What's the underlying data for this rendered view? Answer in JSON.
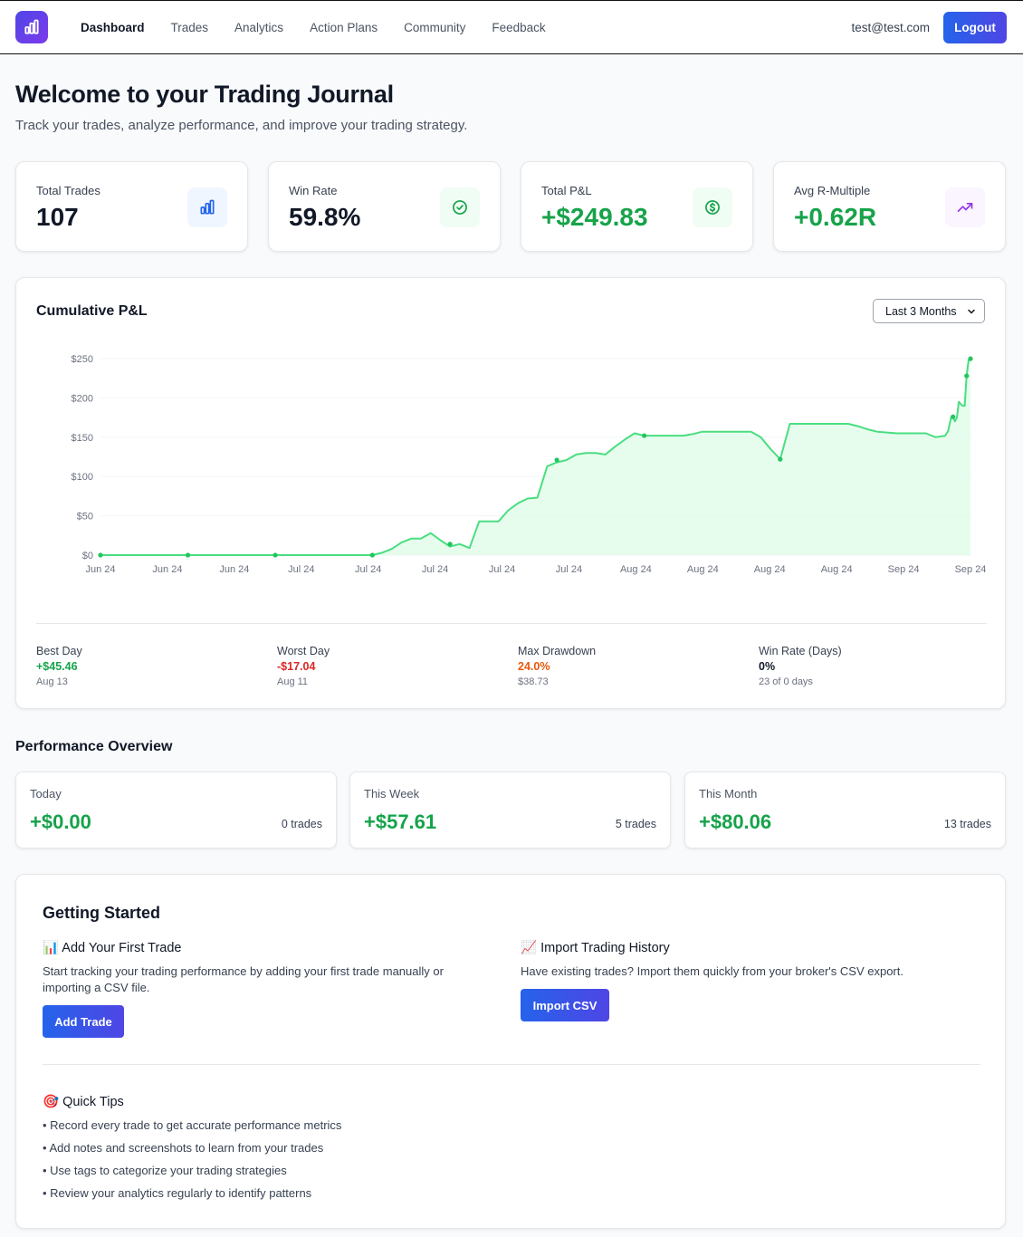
{
  "nav": {
    "items": [
      {
        "label": "Dashboard",
        "active": true
      },
      {
        "label": "Trades"
      },
      {
        "label": "Analytics"
      },
      {
        "label": "Action Plans"
      },
      {
        "label": "Community"
      },
      {
        "label": "Feedback"
      }
    ],
    "user_email": "test@test.com",
    "logout_label": "Logout"
  },
  "header": {
    "title": "Welcome to your Trading Journal",
    "subtitle": "Track your trades, analyze performance, and improve your trading strategy."
  },
  "stats": [
    {
      "label": "Total Trades",
      "value": "107",
      "icon": "bar-chart-icon"
    },
    {
      "label": "Win Rate",
      "value": "59.8%",
      "icon": "check-circle-icon"
    },
    {
      "label": "Total P&L",
      "value": "+$249.83",
      "icon": "dollar-circle-icon"
    },
    {
      "label": "Avg R-Multiple",
      "value": "+0.62R",
      "icon": "trend-up-icon"
    }
  ],
  "chart_card": {
    "title": "Cumulative P&L",
    "range_selected": "Last 3 Months"
  },
  "chart_data": {
    "type": "area",
    "title": "Cumulative P&L",
    "xlabel": "",
    "ylabel": "",
    "ylim": [
      0,
      250
    ],
    "y_ticks": [
      "$0",
      "$50",
      "$100",
      "$150",
      "$200",
      "$250"
    ],
    "y_tick_values": [
      0,
      50,
      100,
      150,
      200,
      250
    ],
    "x_tick_labels": [
      "Jun 24",
      "Jun 24",
      "Jun 24",
      "Jul 24",
      "Jul 24",
      "Jul 24",
      "Jul 24",
      "Jul 24",
      "Aug 24",
      "Aug 24",
      "Aug 24",
      "Aug 24",
      "Sep 24",
      "Sep 24"
    ],
    "x_range": [
      0,
      88
    ],
    "grid": true,
    "line_color": "#4ade80",
    "fill_color": "#dcfce7",
    "points": [
      [
        0,
        0
      ],
      [
        9,
        0
      ],
      [
        18,
        0
      ],
      [
        27,
        0
      ],
      [
        28,
        0
      ],
      [
        29,
        3
      ],
      [
        30,
        8
      ],
      [
        31,
        16
      ],
      [
        32,
        21
      ],
      [
        33,
        21
      ],
      [
        34,
        28
      ],
      [
        35,
        19
      ],
      [
        36,
        11
      ],
      [
        37,
        14
      ],
      [
        38,
        9
      ],
      [
        39,
        43
      ],
      [
        40,
        43
      ],
      [
        41,
        43
      ],
      [
        42,
        57
      ],
      [
        43,
        66
      ],
      [
        44,
        72
      ],
      [
        45,
        73
      ],
      [
        46,
        113
      ],
      [
        47,
        118
      ],
      [
        48,
        121
      ],
      [
        49,
        128
      ],
      [
        50,
        130
      ],
      [
        51,
        130
      ],
      [
        52,
        128
      ],
      [
        53,
        138
      ],
      [
        54,
        147
      ],
      [
        55,
        155
      ],
      [
        56,
        152
      ],
      [
        57,
        152
      ],
      [
        58,
        152
      ],
      [
        59,
        152
      ],
      [
        60,
        152
      ],
      [
        61,
        154
      ],
      [
        62,
        157
      ],
      [
        63,
        157
      ],
      [
        64,
        157
      ],
      [
        65,
        157
      ],
      [
        66,
        157
      ],
      [
        67,
        157
      ],
      [
        68,
        150
      ],
      [
        69,
        135
      ],
      [
        70,
        122
      ],
      [
        71,
        167
      ],
      [
        72,
        167
      ],
      [
        73,
        167
      ],
      [
        74,
        167
      ],
      [
        75,
        167
      ],
      [
        76,
        167
      ],
      [
        77,
        167
      ],
      [
        78,
        164
      ],
      [
        79,
        160
      ],
      [
        80,
        157
      ],
      [
        81,
        156
      ],
      [
        82,
        155
      ],
      [
        83,
        155
      ],
      [
        84,
        155
      ],
      [
        85,
        155
      ],
      [
        86,
        150
      ],
      [
        87,
        152
      ]
    ],
    "points_tail": [
      [
        87.3,
        158
      ],
      [
        87.6,
        175
      ],
      [
        87.8,
        176
      ],
      [
        88.0,
        170
      ],
      [
        88.2,
        175
      ],
      [
        88.4,
        195
      ],
      [
        88.6,
        192
      ],
      [
        88.8,
        190
      ],
      [
        89.0,
        190
      ],
      [
        89.2,
        228
      ],
      [
        89.4,
        248
      ],
      [
        89.6,
        249.83
      ]
    ],
    "markers": [
      [
        0,
        0
      ],
      [
        9,
        0
      ],
      [
        18,
        0
      ],
      [
        28,
        0
      ],
      [
        36,
        14
      ],
      [
        47,
        121
      ],
      [
        56,
        152
      ],
      [
        70,
        122
      ],
      [
        87.8,
        176
      ],
      [
        89.2,
        228
      ],
      [
        89.6,
        249.83
      ]
    ]
  },
  "chart_metrics": [
    {
      "label": "Best Day",
      "value": "+$45.46",
      "sub": "Aug 13",
      "color": "#16a34a"
    },
    {
      "label": "Worst Day",
      "value": "-$17.04",
      "sub": "Aug 11",
      "color": "#dc2626"
    },
    {
      "label": "Max Drawdown",
      "value": "24.0%",
      "sub": "$38.73",
      "color": "#ea580c"
    },
    {
      "label": "Win Rate (Days)",
      "value": "0%",
      "sub": "23 of 0 days",
      "color": "#111827"
    }
  ],
  "performance": {
    "title": "Performance Overview",
    "cards": [
      {
        "label": "Today",
        "value": "+$0.00",
        "count": "0 trades"
      },
      {
        "label": "This Week",
        "value": "+$57.61",
        "count": "5 trades"
      },
      {
        "label": "This Month",
        "value": "+$80.06",
        "count": "13 trades"
      }
    ]
  },
  "getting_started": {
    "title": "Getting Started",
    "add_trade": {
      "heading": "📊 Add Your First Trade",
      "text": "Start tracking your trading performance by adding your first trade manually or importing a CSV file.",
      "button": "Add Trade"
    },
    "import": {
      "heading": "📈 Import Trading History",
      "text": "Have existing trades? Import them quickly from your broker's CSV export.",
      "button": "Import CSV"
    },
    "tips_heading": "🎯 Quick Tips",
    "tips": [
      "• Record every trade to get accurate performance metrics",
      "• Add notes and screenshots to learn from your trades",
      "• Use tags to categorize your trading strategies",
      "• Review your analytics regularly to identify patterns"
    ]
  },
  "colors": {
    "accent": "#2563eb",
    "positive": "#16a34a",
    "negative": "#dc2626",
    "warning": "#ea580c"
  }
}
